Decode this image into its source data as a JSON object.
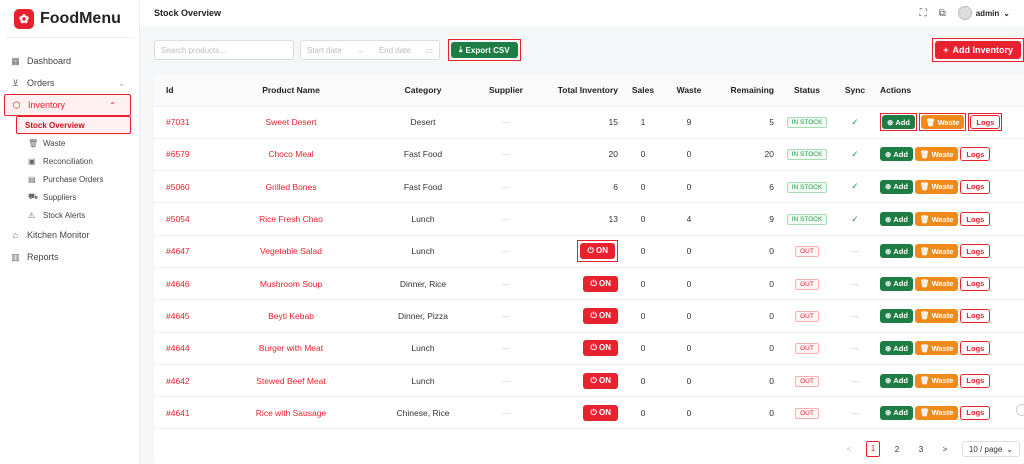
{
  "app": {
    "name": "FoodMenu",
    "logo_glyph": "✿"
  },
  "sidebar": {
    "items": [
      {
        "label": "Dashboard",
        "icon": "grid-icon",
        "glyph": "▦"
      },
      {
        "label": "Orders",
        "icon": "cart-icon",
        "glyph": "⊻",
        "chevron": "⌄"
      },
      {
        "label": "Inventory",
        "icon": "box-icon",
        "glyph": "⬡",
        "chevron": "⌃"
      },
      {
        "label": "Kitchen Monitor",
        "icon": "chef-hat-icon",
        "glyph": "⌂"
      },
      {
        "label": "Reports",
        "icon": "bar-chart-icon",
        "glyph": "▥"
      }
    ],
    "sub_items": [
      {
        "label": "Stock Overview",
        "glyph": ""
      },
      {
        "label": "Waste",
        "glyph": "🗑"
      },
      {
        "label": "Reconciliation",
        "glyph": "▣"
      },
      {
        "label": "Purchase Orders",
        "glyph": "▤"
      },
      {
        "label": "Suppliers",
        "glyph": "⛟"
      },
      {
        "label": "Stock Alerts",
        "glyph": "⚠"
      }
    ]
  },
  "header": {
    "title": "Stock Overview",
    "user": "admin",
    "user_chevron": "⌄",
    "fullscreen_glyph": "⛶",
    "expand_glyph": "⧉"
  },
  "toolbar": {
    "search_placeholder": "Search products...",
    "start_date": "Start date",
    "arrow": "→",
    "end_date": "End date",
    "calendar_glyph": "▭",
    "export_label": "Export CSV",
    "export_glyph": "⤓",
    "add_inventory_label": "Add Inventory",
    "add_glyph": "+"
  },
  "table": {
    "headers": [
      "Id",
      "Product Name",
      "Category",
      "Supplier",
      "Total Inventory",
      "Sales",
      "Waste",
      "Remaining",
      "Status",
      "Sync",
      "Actions"
    ],
    "rows": [
      {
        "id": "#7031",
        "name": "Sweet Desert",
        "category": "Desert",
        "supplier": "—",
        "total": "15",
        "sales": "1",
        "waste": "9",
        "remaining": "5",
        "status": "IN STOCK",
        "sync": "✓",
        "on": false
      },
      {
        "id": "#6579",
        "name": "Choco Meal",
        "category": "Fast Food",
        "supplier": "—",
        "total": "20",
        "sales": "0",
        "waste": "0",
        "remaining": "20",
        "status": "IN STOCK",
        "sync": "✓",
        "on": false
      },
      {
        "id": "#5060",
        "name": "Grilled Bones",
        "category": "Fast Food",
        "supplier": "—",
        "total": "6",
        "sales": "0",
        "waste": "0",
        "remaining": "6",
        "status": "IN STOCK",
        "sync": "✓",
        "on": false
      },
      {
        "id": "#5054",
        "name": "Rice Fresh Chao",
        "category": "Lunch",
        "supplier": "—",
        "total": "13",
        "sales": "0",
        "waste": "4",
        "remaining": "9",
        "status": "IN STOCK",
        "sync": "✓",
        "on": false
      },
      {
        "id": "#4647",
        "name": "Vegetable Salad",
        "category": "Lunch",
        "supplier": "—",
        "total": "ON",
        "sales": "0",
        "waste": "0",
        "remaining": "0",
        "status": "OUT",
        "sync": "—",
        "on": true
      },
      {
        "id": "#4646",
        "name": "Mushroom Soup",
        "category": "Dinner, Rice",
        "supplier": "—",
        "total": "ON",
        "sales": "0",
        "waste": "0",
        "remaining": "0",
        "status": "OUT",
        "sync": "—",
        "on": true
      },
      {
        "id": "#4645",
        "name": "Beyti Kebab",
        "category": "Dinner, Pizza",
        "supplier": "—",
        "total": "ON",
        "sales": "0",
        "waste": "0",
        "remaining": "0",
        "status": "OUT",
        "sync": "—",
        "on": true
      },
      {
        "id": "#4644",
        "name": "Burger with Meat",
        "category": "Lunch",
        "supplier": "—",
        "total": "ON",
        "sales": "0",
        "waste": "0",
        "remaining": "0",
        "status": "OUT",
        "sync": "—",
        "on": true
      },
      {
        "id": "#4642",
        "name": "Stewed Beef Meat",
        "category": "Lunch",
        "supplier": "—",
        "total": "ON",
        "sales": "0",
        "waste": "0",
        "remaining": "0",
        "status": "OUT",
        "sync": "—",
        "on": true
      },
      {
        "id": "#4641",
        "name": "Rice with Sausage",
        "category": "Chinese, Rice",
        "supplier": "—",
        "total": "ON",
        "sales": "0",
        "waste": "0",
        "remaining": "0",
        "status": "OUT",
        "sync": "—",
        "on": true
      }
    ],
    "actions": {
      "add": "Add",
      "waste": "Waste",
      "logs": "Logs",
      "add_glyph": "⊕",
      "waste_glyph": "🗑",
      "on_glyph": "⏻"
    }
  },
  "pagination": {
    "prev": "<",
    "pages": [
      "1",
      "2",
      "3"
    ],
    "next": ">",
    "page_size": "10 / page",
    "size_chevron": "⌄"
  },
  "colors": {
    "brand": "#e8212f",
    "success": "#1e7d44",
    "warning": "#f08b1a"
  }
}
